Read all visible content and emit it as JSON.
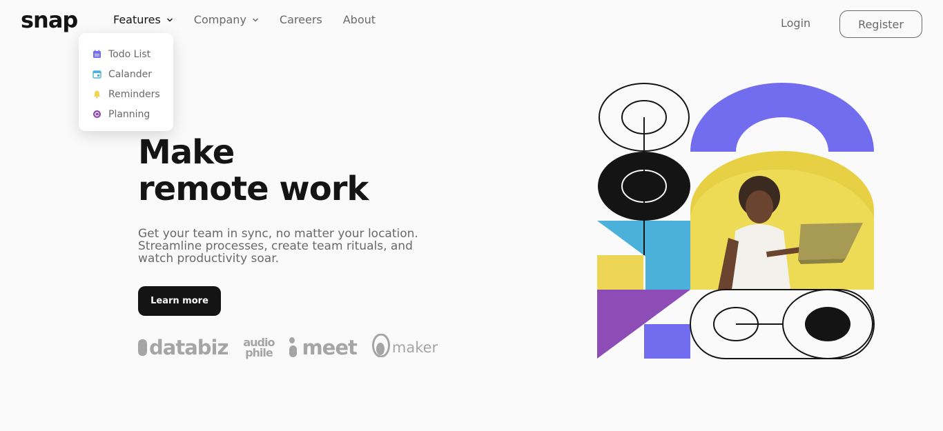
{
  "header": {
    "logo": "snap",
    "nav": [
      {
        "label": "Features",
        "dropdown": true,
        "active": true
      },
      {
        "label": "Company",
        "dropdown": true,
        "active": false
      },
      {
        "label": "Careers",
        "dropdown": false,
        "active": false
      },
      {
        "label": "About",
        "dropdown": false,
        "active": false
      }
    ],
    "login_label": "Login",
    "register_label": "Register"
  },
  "features_menu": {
    "items": [
      {
        "label": "Todo List",
        "icon": "todo-list-icon",
        "color": "#726cee"
      },
      {
        "label": "Calander",
        "icon": "calendar-icon",
        "color": "#4bb1da"
      },
      {
        "label": "Reminders",
        "icon": "bell-icon",
        "color": "#edd556"
      },
      {
        "label": "Planning",
        "icon": "planning-icon",
        "color": "#8e4cb6"
      }
    ]
  },
  "hero": {
    "title_line1": "Make",
    "title_line2": "remote work",
    "description": "Get your team in sync, no matter your location. Streamline processes, create team rituals, and watch productivity soar.",
    "cta_label": "Learn more"
  },
  "clients": {
    "databiz": "databiz",
    "audiophile_line1": "audio",
    "audiophile_line2": "phile",
    "meet": "meet",
    "maker": "maker"
  },
  "colors": {
    "dark": "#141414",
    "gray": "#696969",
    "light_gray": "#a5a5a5",
    "background": "#fafafa",
    "blue": "#4bb1da",
    "purple_blue": "#726cee",
    "yellow": "#edd556",
    "purple": "#8e4cb6"
  }
}
